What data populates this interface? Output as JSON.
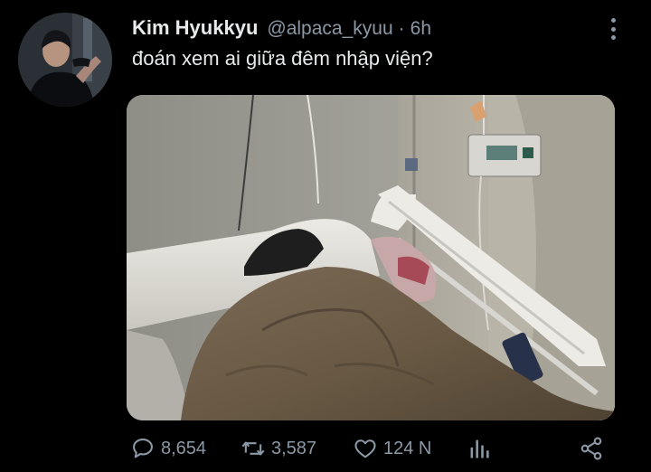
{
  "tweet": {
    "author": {
      "display_name": "Kim Hyukkyu",
      "handle": "@alpaca_kyuu",
      "separator": "·",
      "time": "6h",
      "avatar_icon": "profile-photo"
    },
    "text": "đoán xem ai giữa đêm nhập viện?",
    "media": {
      "description_icon": "hospital-bed-photo"
    },
    "actions": {
      "reply": {
        "icon": "reply-icon",
        "count": "8,654"
      },
      "retweet": {
        "icon": "retweet-icon",
        "count": "3,587"
      },
      "like": {
        "icon": "heart-icon",
        "count": "124 N"
      },
      "analytics": {
        "icon": "analytics-icon"
      },
      "share": {
        "icon": "share-icon"
      }
    }
  },
  "colors": {
    "background": "#000000",
    "primary_text": "#e7e9ea",
    "secondary_text": "#8b98a5"
  }
}
